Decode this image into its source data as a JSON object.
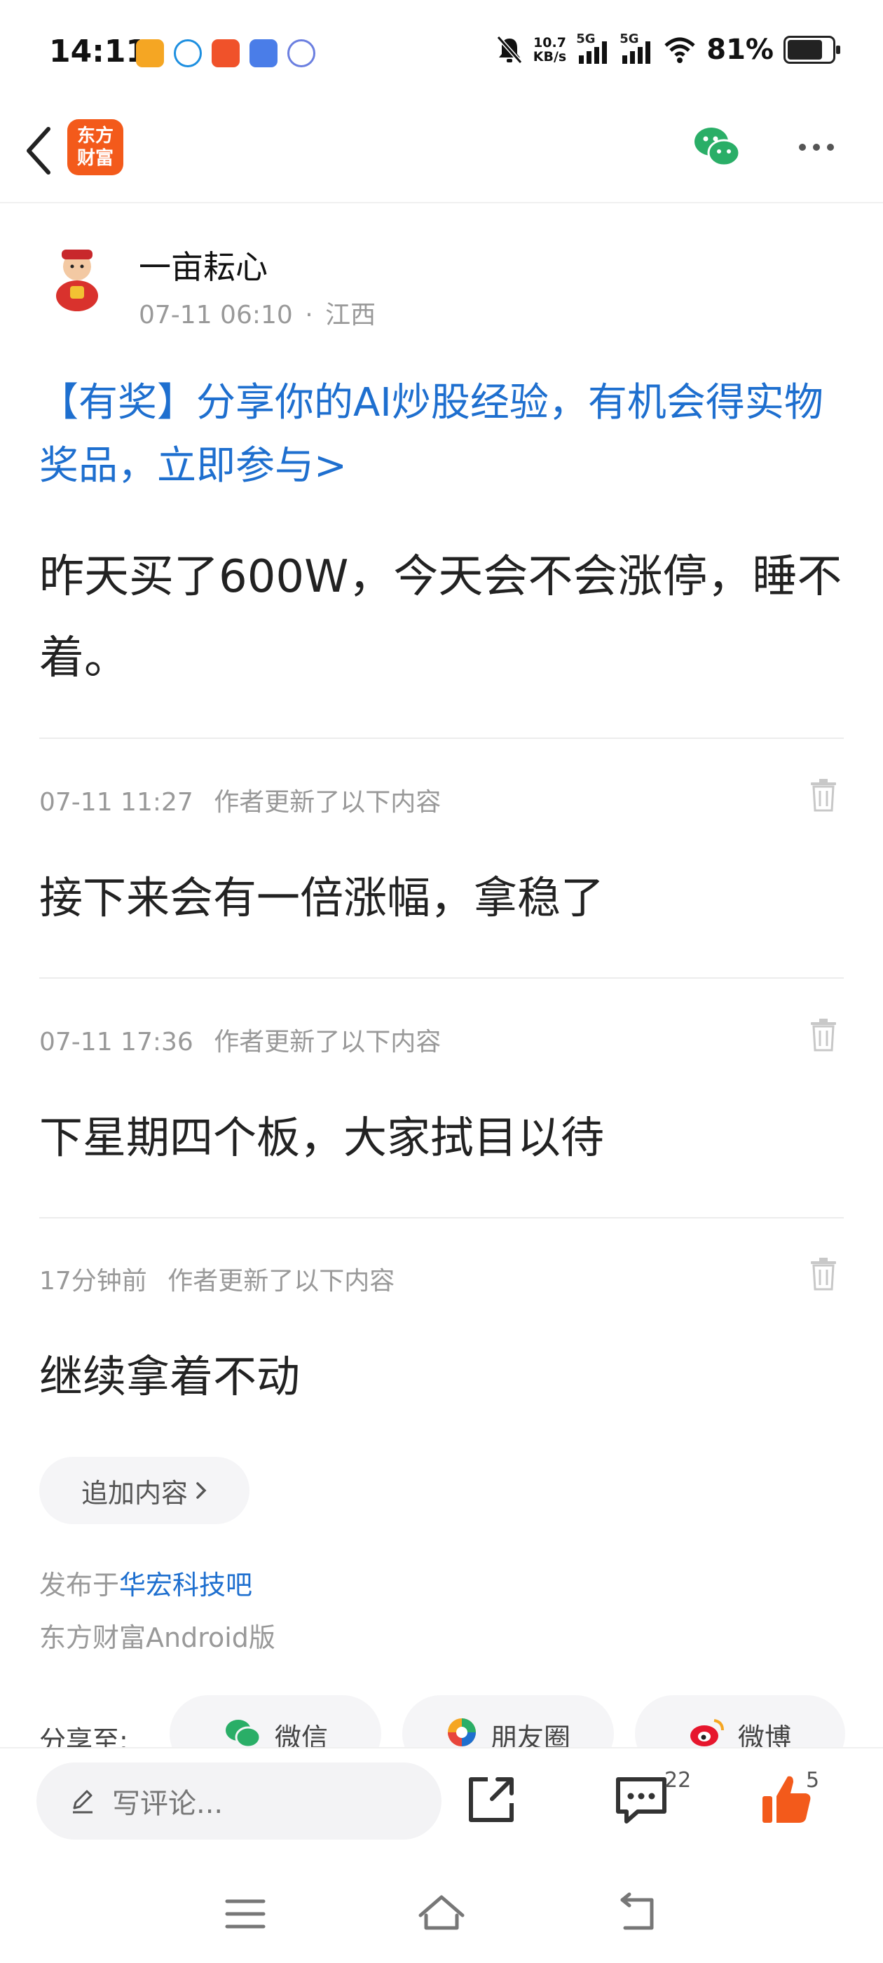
{
  "status_bar": {
    "time": "14:11",
    "net_speed_value": "10.7",
    "net_speed_unit": "KB/s",
    "signal1": "5G",
    "signal2": "5G",
    "battery_percent": "81%",
    "battery_level": 0.81
  },
  "header": {
    "logo_line1": "东方",
    "logo_line2": "财富",
    "brand_color": "#f35a1b"
  },
  "post": {
    "author": "一亩耘心",
    "date": "07-11 06:10",
    "separator": "·",
    "location": "江西",
    "promo_text": "【有奖】分享你的AI炒股经验，有机会得实物奖品，立即参与>",
    "body": "昨天买了600W，今天会不会涨停，睡不着。"
  },
  "updates": [
    {
      "time": "07-11 11:27",
      "note": "作者更新了以下内容",
      "text": "接下来会有一倍涨幅，拿稳了"
    },
    {
      "time": "07-11 17:36",
      "note": "作者更新了以下内容",
      "text": "下星期四个板，大家拭目以待"
    },
    {
      "time": "17分钟前",
      "note": "作者更新了以下内容",
      "text": "继续拿着不动"
    }
  ],
  "add_content_label": "追加内容",
  "published": {
    "prefix": "发布于",
    "forum": "华宏科技吧",
    "client": "东方财富Android版"
  },
  "share": {
    "label": "分享至:",
    "targets": [
      "微信",
      "朋友圈",
      "微博"
    ]
  },
  "bottom_bar": {
    "comment_placeholder": "写评论...",
    "comment_count": "22",
    "like_count": "5"
  },
  "colors": {
    "link": "#1e6fcf",
    "wechat": "#2aae67",
    "like": "#f35a1b"
  }
}
